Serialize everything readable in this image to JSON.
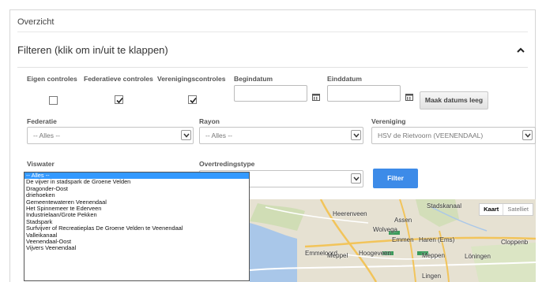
{
  "page": {
    "title": "Overzicht"
  },
  "filter": {
    "header": "Filteren (klik om in/uit te klappen)",
    "checkboxes": [
      {
        "label": "Eigen controles",
        "checked": false
      },
      {
        "label": "Federatieve controles",
        "checked": true
      },
      {
        "label": "Verenigingscontroles",
        "checked": true
      }
    ],
    "begin_date": {
      "label": "Begindatum",
      "value": ""
    },
    "end_date": {
      "label": "Einddatum",
      "value": ""
    },
    "clear_dates_label": "Maak datums leeg",
    "federation": {
      "label": "Federatie",
      "value": "-- Alles --"
    },
    "district": {
      "label": "Rayon",
      "value": "-- Alles --"
    },
    "association": {
      "label": "Vereniging",
      "value": "HSV de Rietvoorn (VEENENDAAL)"
    },
    "water": {
      "label": "Viswater",
      "options": [
        "-- Alles --",
        "De vijver in stadspark de Groene Velden",
        "Dragonder-Oost",
        "driehoeken",
        "Gemeentewateren Veenendaal",
        "Het Spinnemeer te Ederveen",
        "Industrielaan/Grote Pekken",
        "Stadspark",
        "Surfvijver of Recreatieplas De Groene Velden te Veenendaal",
        "Valleikanaal",
        "Veenendaal-Oost",
        "Vijvers Veenendaal"
      ],
      "selected_index": 0
    },
    "violation_type": {
      "label": "Overtredingstype",
      "value": ""
    },
    "filter_button": "Filter"
  },
  "map": {
    "maptype_map": "Kaart",
    "maptype_satellite": "Satelliet",
    "places": [
      "Heerenveen",
      "Assen",
      "Stadskanaal",
      "Wolvega",
      "Emmen",
      "Haren (Ems)",
      "Cloppenb",
      "Emmeloord",
      "Meppel",
      "Hoogeveen",
      "Meppen",
      "Löningen",
      "Lingen"
    ],
    "colors": {
      "land": "#e6e1d2",
      "water": "#a9c7e9",
      "road": "#f2c45a",
      "green": "#c6dca8"
    }
  },
  "colors": {
    "accent": "#3d8be8",
    "selection": "#3399ff"
  }
}
